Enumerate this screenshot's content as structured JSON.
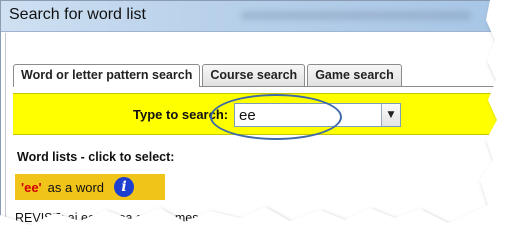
{
  "window": {
    "title": "Search for word list"
  },
  "tabs": [
    {
      "label": "Word or letter pattern search",
      "active": true
    },
    {
      "label": "Course search",
      "active": false
    },
    {
      "label": "Game search",
      "active": false
    }
  ],
  "search": {
    "label": "Type to search:",
    "value": "ee"
  },
  "word_lists": {
    "heading": "Word lists - click to select:",
    "items": [
      {
        "key": "'ee'",
        "suffix": "as a word",
        "icon": "info-icon"
      }
    ],
    "partial_row": "REVISE: ai ee igh oa graphemes"
  },
  "colors": {
    "highlight": "#ffff00",
    "selected_item": "#f0c419",
    "oval": "#3e6aa8",
    "info": "#1d3fcf"
  }
}
